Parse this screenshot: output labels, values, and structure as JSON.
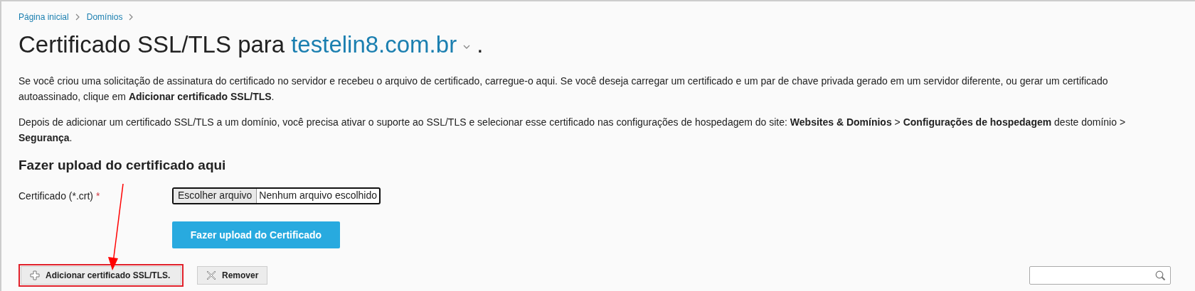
{
  "breadcrumb": [
    "Página inicial",
    "Domínios"
  ],
  "title": {
    "text": "Certificado SSL/TLS para",
    "domain": "testelin8.com.br",
    "end": "."
  },
  "paragraphs": [
    "Se você criou uma solicitação de assinatura do certificado no servidor e recebeu o arquivo de certificado, carregue-o aqui. Se você deseja carregar um certificado e um par de chave privada gerado em um servidor diferente, ou gerar um certificado autoassinado, clique em **Adicionar certificado SSL/TLS**.",
    "Depois de adicionar um certificado SSL/TLS a um domínio, você precisa ativar o suporte ao SSL/TLS e selecionar esse certificado nas configurações de hospedagem do site: **Websites & Domínios** > **Configurações de hospedagem** deste domínio > **Segurança**."
  ],
  "upload": {
    "heading": "Fazer upload do certificado aqui",
    "label": "Certificado (*.crt)",
    "required_mark": "*",
    "file_button": "Escolher arquivo",
    "file_status": "Nenhum arquivo escolhido",
    "submit": "Fazer upload do Certificado"
  },
  "toolbar": [
    {
      "kind": "add",
      "label": "Adicionar certificado SSL/TLS.",
      "highlighted": true
    },
    {
      "kind": "remove",
      "label": "Remover",
      "highlighted": false
    }
  ]
}
